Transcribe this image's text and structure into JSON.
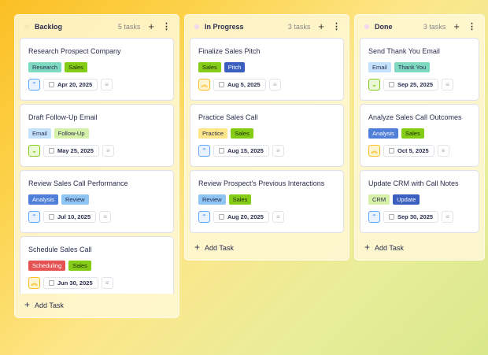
{
  "columns": [
    {
      "title": "Backlog",
      "count": "5 tasks",
      "dot": "#f5e7b8",
      "add_label": "Add Task",
      "cards": [
        {
          "title": "Research Prospect Company",
          "tags": [
            {
              "label": "Research",
              "bg": "#7dd9c0",
              "fg": "#2a2d4e"
            },
            {
              "label": "Sales",
              "bg": "#84cc16",
              "fg": "#1f2d0a"
            }
          ],
          "priority": "up",
          "date": "Apr 20, 2025"
        },
        {
          "title": "Draft Follow-Up Email",
          "tags": [
            {
              "label": "Email",
              "bg": "#c4e2fb",
              "fg": "#2a2d4e"
            },
            {
              "label": "Follow-Up",
              "bg": "#d5f0a8",
              "fg": "#2a2d4e"
            }
          ],
          "priority": "down",
          "date": "May 25, 2025"
        },
        {
          "title": "Review Sales Call Performance",
          "tags": [
            {
              "label": "Analysis",
              "bg": "#4f7fd9",
              "fg": "#ffffff"
            },
            {
              "label": "Review",
              "bg": "#8ec5f5",
              "fg": "#2a2d4e"
            }
          ],
          "priority": "up",
          "date": "Jul 10, 2025"
        },
        {
          "title": "Schedule Sales Call",
          "tags": [
            {
              "label": "Scheduling",
              "bg": "#e55353",
              "fg": "#ffffff"
            },
            {
              "label": "Sales",
              "bg": "#84cc16",
              "fg": "#1f2d0a"
            }
          ],
          "priority": "double-up",
          "date": "Jun 30, 2025"
        }
      ]
    },
    {
      "title": "In Progress",
      "count": "3 tasks",
      "dot": "#f3d6f0",
      "add_label": "Add Task",
      "cards": [
        {
          "title": "Finalize Sales Pitch",
          "tags": [
            {
              "label": "Sales",
              "bg": "#84cc16",
              "fg": "#1f2d0a"
            },
            {
              "label": "Pitch",
              "bg": "#3b5fbf",
              "fg": "#ffffff"
            }
          ],
          "priority": "double-up",
          "date": "Aug 5, 2025"
        },
        {
          "title": "Practice Sales Call",
          "tags": [
            {
              "label": "Practice",
              "bg": "#fde68a",
              "fg": "#2a2d4e"
            },
            {
              "label": "Sales",
              "bg": "#84cc16",
              "fg": "#1f2d0a"
            }
          ],
          "priority": "up",
          "date": "Aug 15, 2025"
        },
        {
          "title": "Review Prospect's Previous Interactions",
          "tags": [
            {
              "label": "Review",
              "bg": "#8ec5f5",
              "fg": "#2a2d4e"
            },
            {
              "label": "Sales",
              "bg": "#84cc16",
              "fg": "#1f2d0a"
            }
          ],
          "priority": "up",
          "date": "Aug 20, 2025"
        }
      ]
    },
    {
      "title": "Done",
      "count": "3 tasks",
      "dot": "#f3d6f0",
      "add_label": "Add Task",
      "cards": [
        {
          "title": "Send Thank You Email",
          "tags": [
            {
              "label": "Email",
              "bg": "#c4e2fb",
              "fg": "#2a2d4e"
            },
            {
              "label": "Thank You",
              "bg": "#7dd9c0",
              "fg": "#2a2d4e"
            }
          ],
          "priority": "down",
          "date": "Sep 25, 2025"
        },
        {
          "title": "Analyze Sales Call Outcomes",
          "tags": [
            {
              "label": "Analysis",
              "bg": "#4f7fd9",
              "fg": "#ffffff"
            },
            {
              "label": "Sales",
              "bg": "#84cc16",
              "fg": "#1f2d0a"
            }
          ],
          "priority": "double-up",
          "date": "Oct 5, 2025"
        },
        {
          "title": "Update CRM with Call Notes",
          "tags": [
            {
              "label": "CRM",
              "bg": "#d5f0a8",
              "fg": "#2a2d4e"
            },
            {
              "label": "Update",
              "bg": "#3b5fbf",
              "fg": "#ffffff"
            }
          ],
          "priority": "up",
          "date": "Sep 30, 2025"
        }
      ]
    }
  ]
}
